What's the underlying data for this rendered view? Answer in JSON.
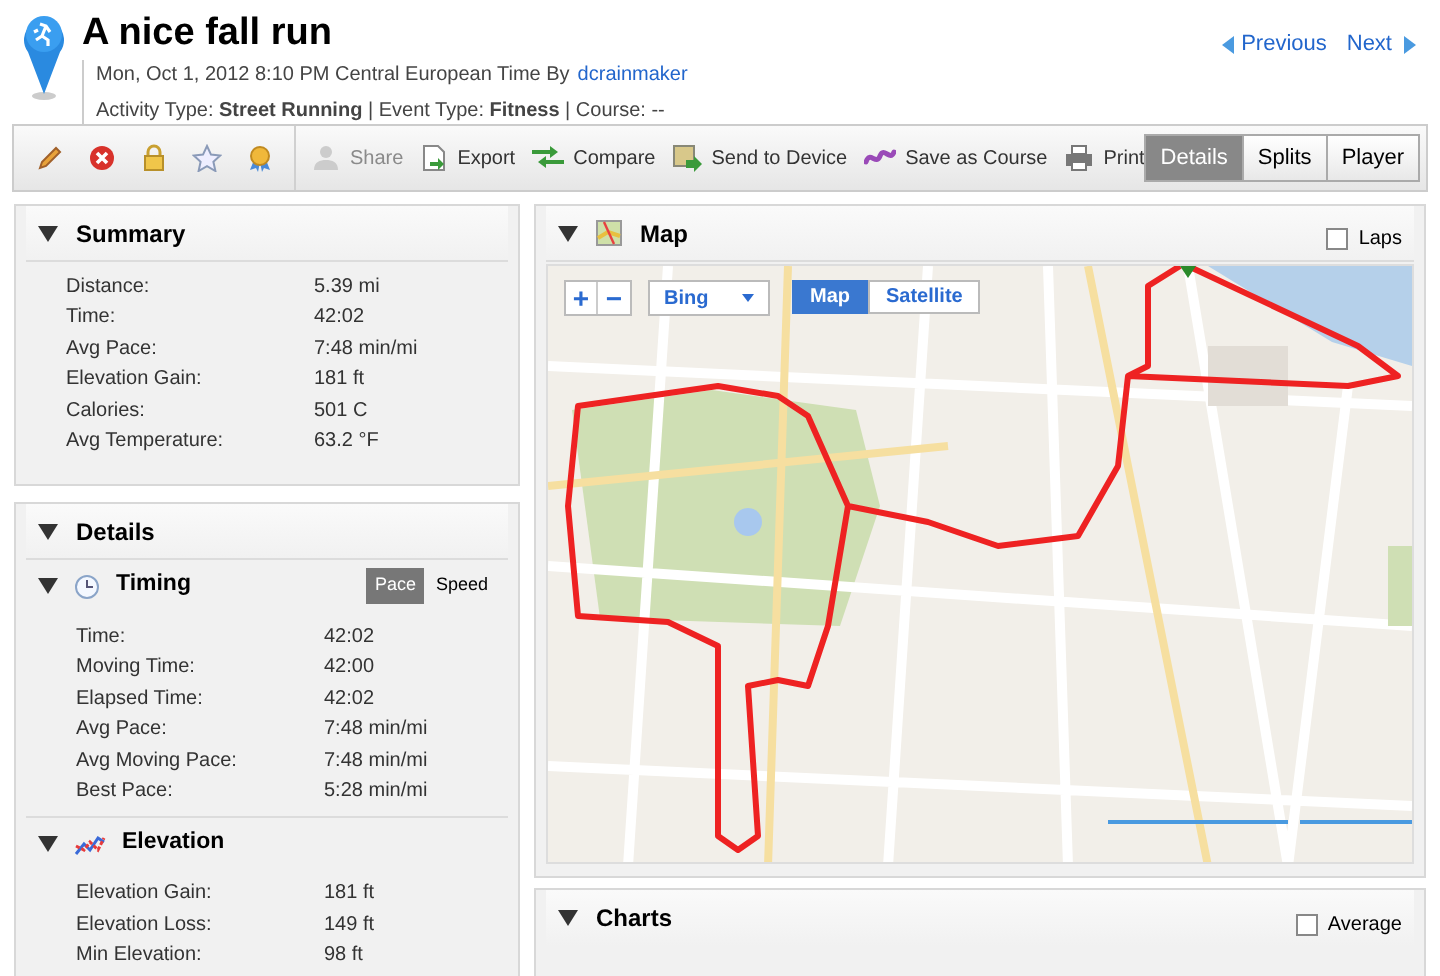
{
  "activity": {
    "title": "A nice fall run",
    "date": "Mon, Oct 1, 2012 8:10 PM Central European Time By",
    "author": "dcrainmaker",
    "meta": "Activity Type: **Street Running** | Event Type: **Fitness** | Course: --"
  },
  "nav": {
    "previous": "Previous",
    "next": "Next"
  },
  "toolbar": {
    "icons": [
      {
        "kind": "edit"
      },
      {
        "kind": "delete"
      },
      {
        "kind": "privacy"
      },
      {
        "kind": "favorite"
      },
      {
        "kind": "badge"
      }
    ],
    "actions": [
      {
        "kind": "share",
        "label": "Share",
        "disabled": true
      },
      {
        "kind": "export",
        "label": "Export",
        "disabled": false
      },
      {
        "kind": "compare",
        "label": "Compare",
        "disabled": false
      },
      {
        "kind": "send",
        "label": "Send to Device",
        "disabled": false
      },
      {
        "kind": "course",
        "label": "Save as Course",
        "disabled": false
      },
      {
        "kind": "print",
        "label": "Print",
        "disabled": false
      }
    ],
    "views": [
      {
        "label": "Details",
        "selected": true
      },
      {
        "label": "Splits",
        "selected": false
      },
      {
        "label": "Player",
        "selected": false
      }
    ]
  },
  "summary": {
    "title": "Summary",
    "rows": [
      {
        "label": "Distance:",
        "value": "5.39 mi"
      },
      {
        "label": "Time:",
        "value": "42:02"
      },
      {
        "label": "Avg Pace:",
        "value": "7:48 min/mi"
      },
      {
        "label": "Elevation Gain:",
        "value": "181 ft"
      },
      {
        "label": "Calories:",
        "value": "501 C"
      },
      {
        "label": "Avg Temperature:",
        "value": "63.2 °F"
      }
    ]
  },
  "details": {
    "title": "Details",
    "sections": [
      {
        "kind": "timing",
        "title": "Timing",
        "toggle": [
          {
            "label": "Pace",
            "selected": true
          },
          {
            "label": "Speed",
            "selected": false
          }
        ],
        "rows": [
          {
            "label": "Time:",
            "value": "42:02"
          },
          {
            "label": "Moving Time:",
            "value": "42:00"
          },
          {
            "label": "Elapsed Time:",
            "value": "42:02"
          },
          {
            "label": "Avg Pace:",
            "value": "7:48 min/mi"
          },
          {
            "label": "Avg Moving Pace:",
            "value": "7:48 min/mi"
          },
          {
            "label": "Best Pace:",
            "value": "5:28 min/mi"
          }
        ]
      },
      {
        "kind": "elevation",
        "title": "Elevation",
        "rows": [
          {
            "label": "Elevation Gain:",
            "value": "181 ft"
          },
          {
            "label": "Elevation Loss:",
            "value": "149 ft"
          },
          {
            "label": "Min Elevation:",
            "value": "98 ft"
          }
        ]
      }
    ]
  },
  "map": {
    "title": "Map",
    "laps": {
      "label": "Laps",
      "checked": false
    },
    "provider": "Bing",
    "zoom_in": "+",
    "zoom_out": "−",
    "modes": [
      {
        "label": "Map",
        "selected": true
      },
      {
        "label": "Satellite",
        "selected": false
      }
    ]
  },
  "charts": {
    "title": "Charts",
    "average": {
      "label": "Average",
      "checked": false
    }
  }
}
